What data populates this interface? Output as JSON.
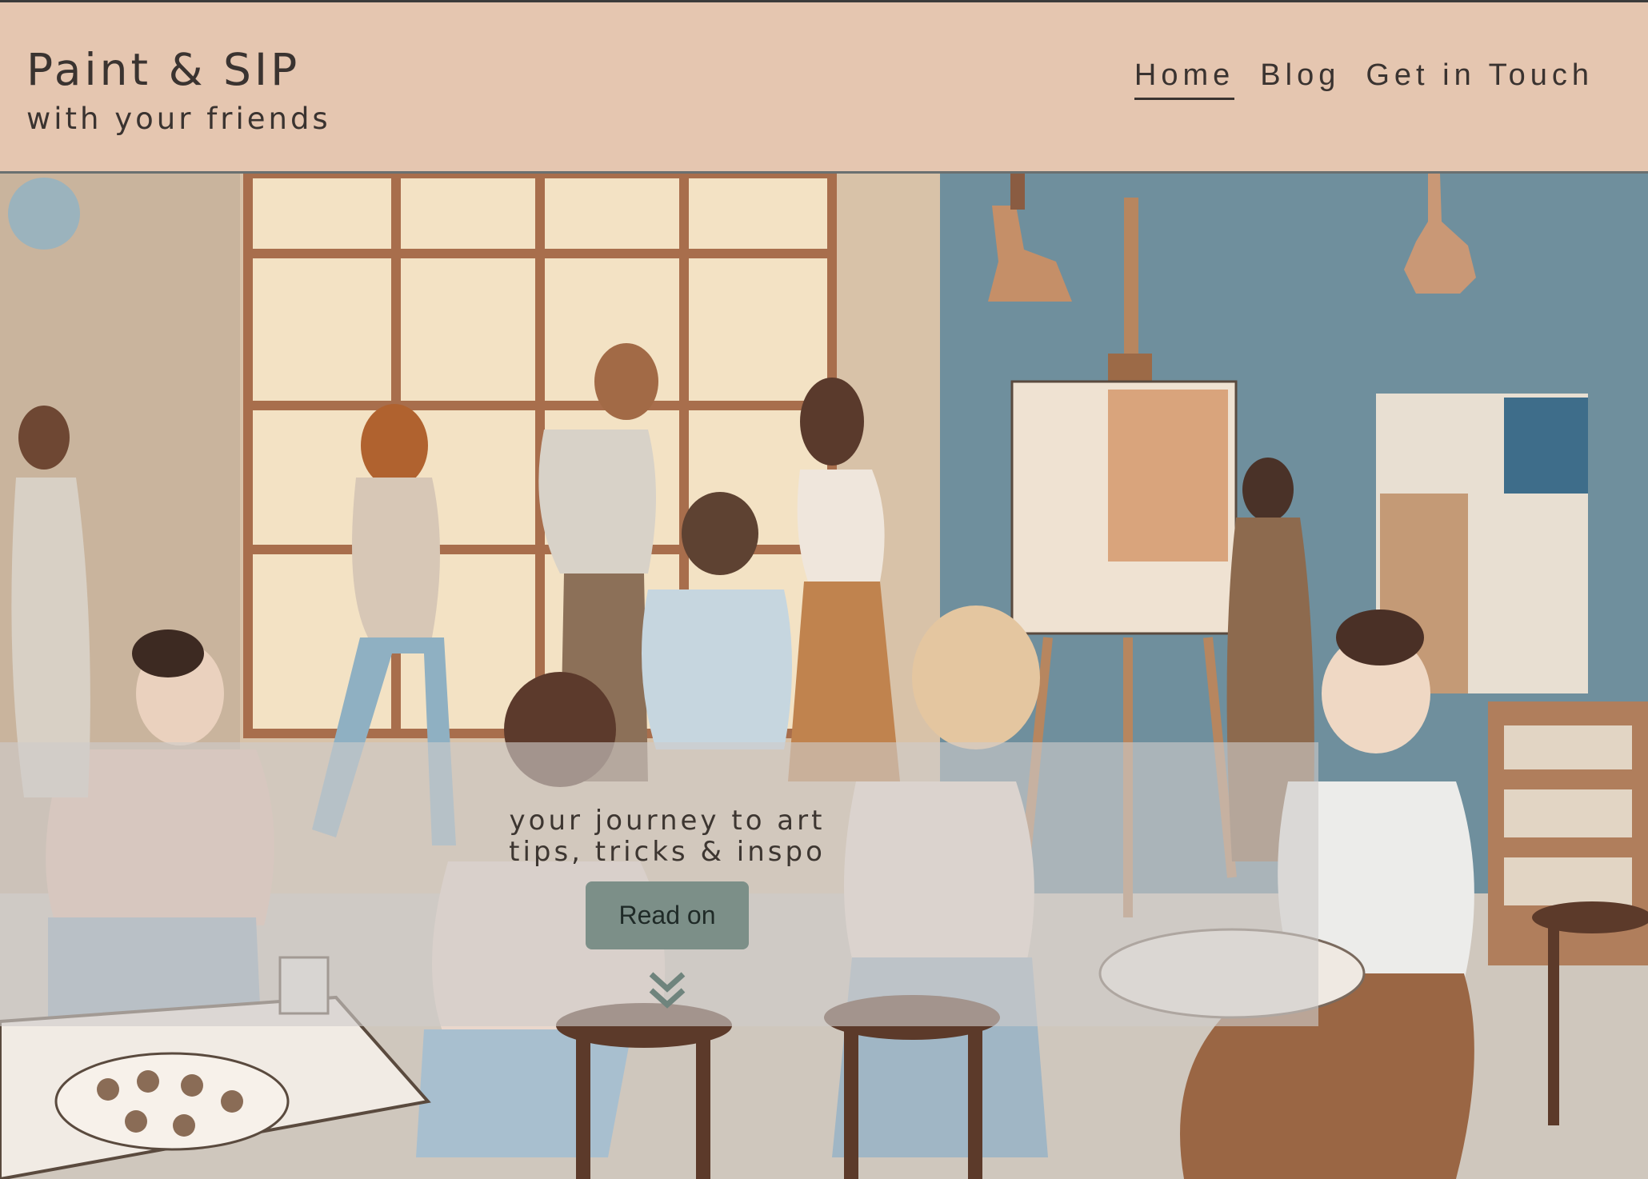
{
  "header": {
    "title": "Paint & SIP",
    "subtitle": "with your friends"
  },
  "nav": {
    "items": [
      {
        "label": "Home",
        "active": true
      },
      {
        "label": "Blog",
        "active": false
      },
      {
        "label": "Get in Touch",
        "active": false
      }
    ]
  },
  "hero": {
    "image": "illustration of a painting class studio with people at easels",
    "tagline_line1": "your journey to art",
    "tagline_line2": "tips, tricks & inspo",
    "cta_label": "Read on",
    "scroll_icon": "double-chevron-down-icon"
  },
  "colors": {
    "header_bg": "#e5c6b0",
    "button_bg": "#7c8f88",
    "text": "#3a3330"
  }
}
